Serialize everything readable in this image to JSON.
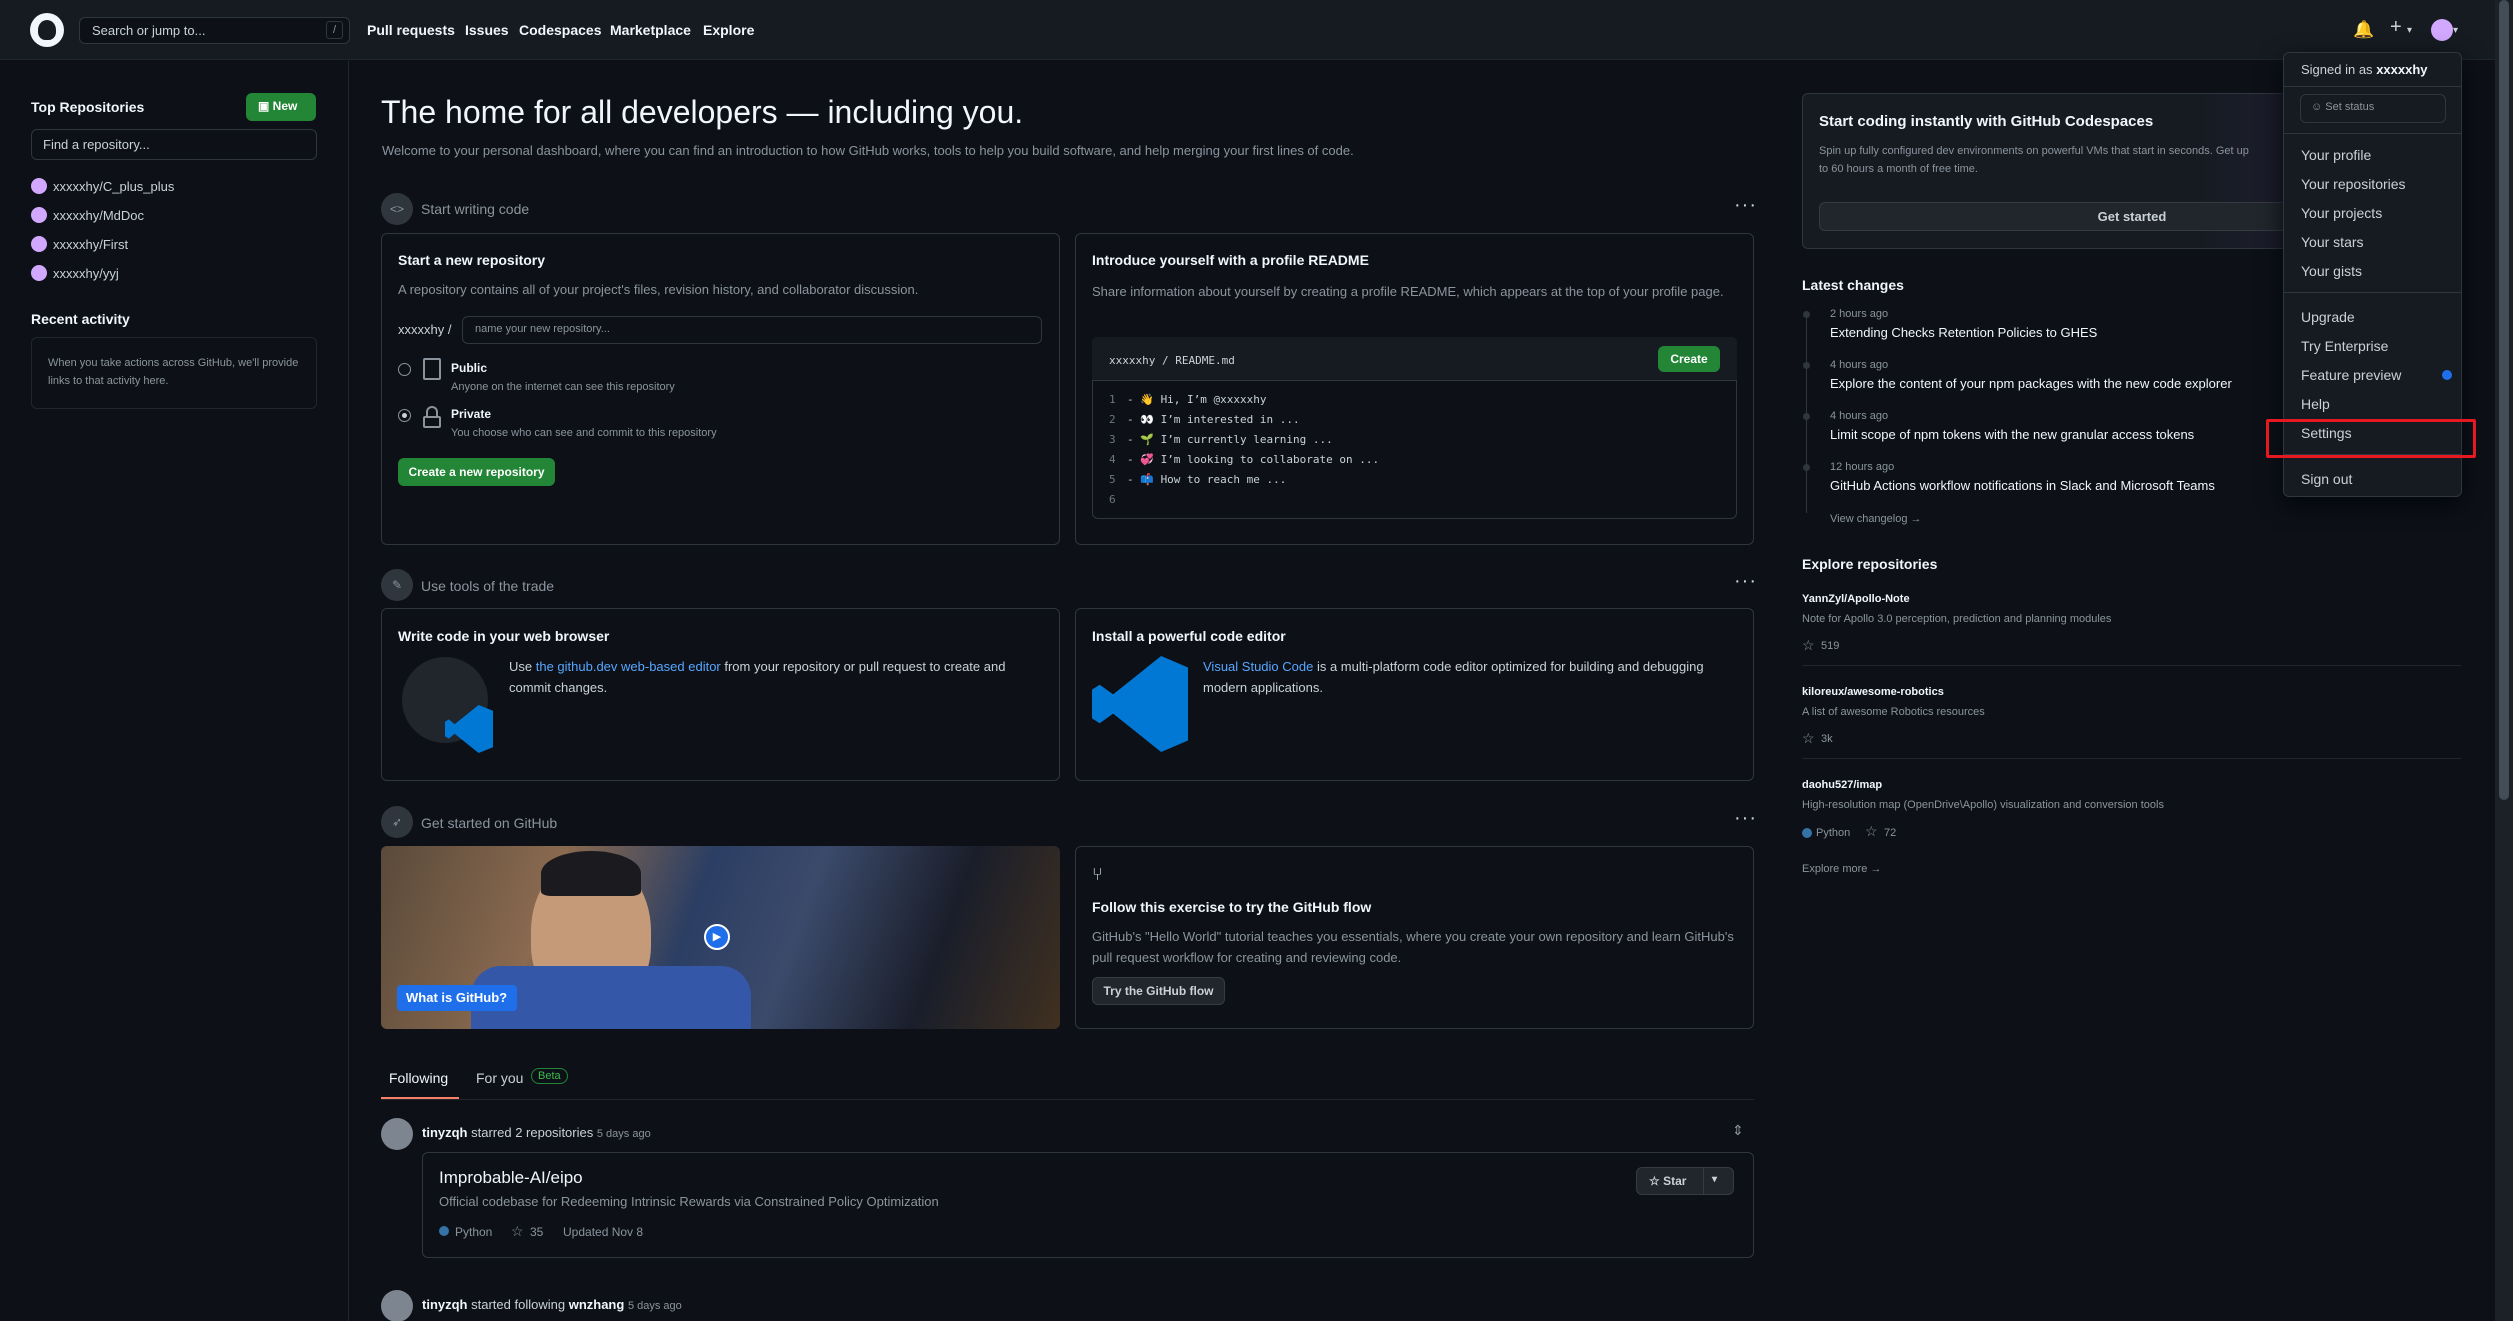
{
  "header": {
    "search_placeholder": "Search or jump to...",
    "slash_key": "/",
    "nav": [
      "Pull requests",
      "Issues",
      "Codespaces",
      "Marketplace",
      "Explore"
    ]
  },
  "sidebar": {
    "top_repos_title": "Top Repositories",
    "new_label": "New",
    "find_placeholder": "Find a repository...",
    "repos": [
      "xxxxxhy/C_plus_plus",
      "xxxxxhy/MdDoc",
      "xxxxxhy/First",
      "xxxxxhy/yyj"
    ],
    "recent_title": "Recent activity",
    "recent_text": "When you take actions across GitHub, we'll provide links to that activity here."
  },
  "main": {
    "title": "The home for all developers — including you.",
    "subtitle": "Welcome to your personal dashboard, where you can find an introduction to how GitHub works, tools to help you build software, and help merging your first lines of code.",
    "section1": "Start writing code",
    "new_repo": {
      "title": "Start a new repository",
      "desc": "A repository contains all of your project's files, revision history, and collaborator discussion.",
      "owner": "xxxxxhy /",
      "name_placeholder": "name your new repository...",
      "public_label": "Public",
      "public_desc": "Anyone on the internet can see this repository",
      "private_label": "Private",
      "private_desc": "You choose who can see and commit to this repository",
      "create_button": "Create a new repository"
    },
    "readme": {
      "title": "Introduce yourself with a profile README",
      "desc": "Share information about yourself by creating a profile README, which appears at the top of your profile page.",
      "path": "xxxxxhy / README.md",
      "create_button": "Create",
      "lines": [
        {
          "n": "1",
          "text": "- 👋 Hi, I’m @xxxxxhy"
        },
        {
          "n": "2",
          "text": "- 👀 I’m interested in ..."
        },
        {
          "n": "3",
          "text": "- 🌱 I’m currently learning ..."
        },
        {
          "n": "4",
          "text": "- 💞️ I’m looking to collaborate on ..."
        },
        {
          "n": "5",
          "text": "- 📫 How to reach me ..."
        },
        {
          "n": "6",
          "text": ""
        }
      ]
    },
    "section2": "Use tools of the trade",
    "web_editor": {
      "title": "Write code in your web browser",
      "pre": "Use ",
      "link": "the github.dev web-based editor",
      "post": " from your repository or pull request to create and commit changes."
    },
    "code_editor": {
      "title": "Install a powerful code editor",
      "link": "Visual Studio Code",
      "post": " is a multi-platform code editor optimized for building and debugging modern applications."
    },
    "section3": "Get started on GitHub",
    "video_label": "What is GitHub?",
    "flow": {
      "title": "Follow this exercise to try the GitHub flow",
      "desc": "GitHub's \"Hello World\" tutorial teaches you essentials, where you create your own repository and learn GitHub's pull request workflow for creating and reviewing code.",
      "button": "Try the GitHub flow"
    },
    "tabs": {
      "following": "Following",
      "for_you": "For you",
      "beta": "Beta"
    },
    "feed1": {
      "user": "tinyzqh",
      "action": "starred 2 repositories",
      "time": "5 days ago",
      "repo": "Improbable-AI/eipo",
      "desc": "Official codebase for Redeeming Intrinsic Rewards via Constrained Policy Optimization",
      "lang": "Python",
      "stars": "35",
      "updated": "Updated Nov 8",
      "star_button": "Star"
    },
    "feed2": {
      "user": "tinyzqh",
      "action": "started following",
      "target": "wnzhang",
      "time": "5 days ago"
    }
  },
  "right": {
    "codespaces": {
      "title": "Start coding instantly with GitHub Codespaces",
      "desc": "Spin up fully configured dev environments on powerful VMs that start in seconds. Get up to 60 hours a month of free time.",
      "button": "Get started"
    },
    "latest_title": "Latest changes",
    "changes": [
      {
        "time": "2 hours ago",
        "text": "Extending Checks Retention Policies to GHES"
      },
      {
        "time": "4 hours ago",
        "text": "Explore the content of your npm packages with the new code explorer"
      },
      {
        "time": "4 hours ago",
        "text": "Limit scope of npm tokens with the new granular access tokens"
      },
      {
        "time": "12 hours ago",
        "text": "GitHub Actions workflow notifications in Slack and Microsoft Teams"
      }
    ],
    "view_changelog": "View changelog →",
    "explore_title": "Explore repositories",
    "explore": [
      {
        "name": "YannZyl/Apollo-Note",
        "desc": "Note for Apollo 3.0 perception, prediction and planning modules",
        "lang": "",
        "stars": "519"
      },
      {
        "name": "kiloreux/awesome-robotics",
        "desc": "A list of awesome Robotics resources",
        "lang": "",
        "stars": "3k"
      },
      {
        "name": "daohu527/imap",
        "desc": "High-resolution map (OpenDrive\\Apollo) visualization and conversion tools",
        "lang": "Python",
        "stars": "72"
      }
    ],
    "explore_more": "Explore more →"
  },
  "dropdown": {
    "signed_in": "Signed in as",
    "username": "xxxxxhy",
    "set_status": "Set status",
    "items1": [
      "Your profile",
      "Your repositories",
      "Your projects",
      "Your stars",
      "Your gists"
    ],
    "items2": [
      "Upgrade",
      "Try Enterprise",
      "Feature preview",
      "Help",
      "Settings"
    ],
    "sign_out": "Sign out"
  },
  "colors": {
    "accent": "#58a6ff",
    "green": "#238636",
    "highlight": "#e5191f",
    "python": "#3572A5"
  }
}
